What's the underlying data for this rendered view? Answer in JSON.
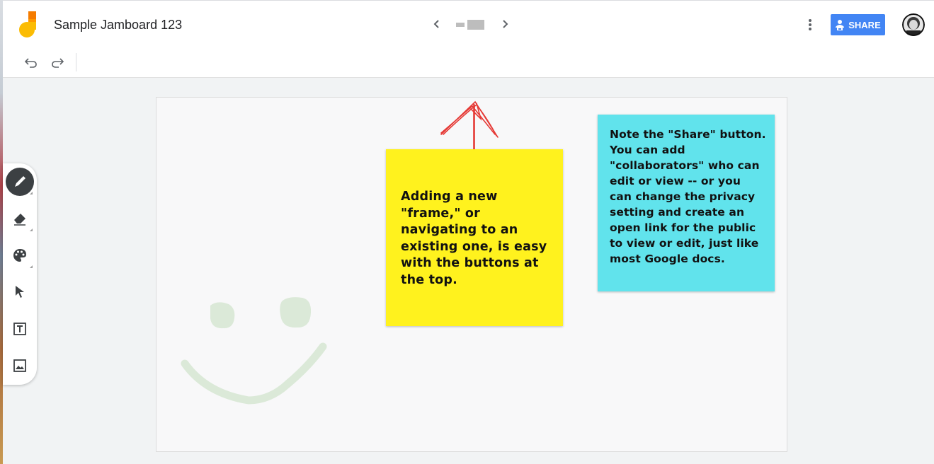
{
  "app": {
    "title": "Sample Jamboard 123"
  },
  "header": {
    "prev_icon": "chevron-left-icon",
    "next_icon": "chevron-right-icon",
    "more_icon": "more-vert-icon",
    "share_label": "SHARE",
    "share_icon": "person-lock-icon",
    "avatar_icon": "user-avatar"
  },
  "toolbar": {
    "undo_icon": "undo-icon",
    "redo_icon": "redo-icon"
  },
  "tools": [
    {
      "name": "pen",
      "icon": "pen-icon",
      "active": true
    },
    {
      "name": "eraser",
      "icon": "eraser-icon",
      "active": false
    },
    {
      "name": "color",
      "icon": "palette-icon",
      "active": false
    },
    {
      "name": "select",
      "icon": "pointer-icon",
      "active": false
    },
    {
      "name": "text",
      "icon": "text-box-icon",
      "active": false
    },
    {
      "name": "image",
      "icon": "image-icon",
      "active": false
    }
  ],
  "canvas": {
    "sticky_notes": [
      {
        "color": "#fff21e",
        "text": "Adding a new \"frame,\" or navigating to an existing one, is easy with the buttons at the top."
      },
      {
        "color": "#61e3ec",
        "text": "Note the \"Share\" button.  You can add \"collaborators\" who can edit or view -- or you can change the privacy setting and create an open link for the public to view or edit, just like most Google docs."
      }
    ],
    "drawings": [
      {
        "shape": "arrow",
        "color": "#e53935"
      },
      {
        "shape": "smiley-face",
        "color": "#dbe9d8"
      }
    ]
  },
  "colors": {
    "share_button": "#4285f4",
    "active_tool": "#3c4043",
    "yellow_note": "#fff21e",
    "cyan_note": "#61e3ec"
  }
}
